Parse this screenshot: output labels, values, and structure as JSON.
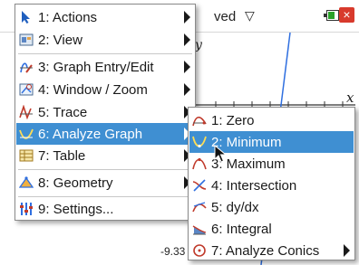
{
  "header": {
    "doc_title": "ved",
    "doc_caret": "▽"
  },
  "graph": {
    "y_label": "y",
    "x_label": "x",
    "x_min_label": "-9.33",
    "colors": {
      "function": "#2f6fe0",
      "axis": "#333333"
    }
  },
  "main_menu": {
    "items": [
      {
        "label": "1: Actions",
        "icon": "pointer-arrow-icon",
        "submenu": true
      },
      {
        "label": "2: View",
        "icon": "view-icon",
        "submenu": true
      },
      {
        "label": "3: Graph Entry/Edit",
        "icon": "graph-entry-icon",
        "submenu": true
      },
      {
        "label": "4: Window / Zoom",
        "icon": "window-zoom-icon",
        "submenu": true
      },
      {
        "label": "5: Trace",
        "icon": "trace-icon",
        "submenu": true
      },
      {
        "label": "6: Analyze Graph",
        "icon": "analyze-graph-icon",
        "submenu": true,
        "highlighted": true
      },
      {
        "label": "7: Table",
        "icon": "table-icon",
        "submenu": true
      },
      {
        "label": "8: Geometry",
        "icon": "geometry-icon",
        "submenu": true
      },
      {
        "label": "9: Settings...",
        "icon": "settings-icon",
        "submenu": false
      }
    ]
  },
  "sub_menu": {
    "items": [
      {
        "label": "1: Zero",
        "icon": "zero-icon"
      },
      {
        "label": "2: Minimum",
        "icon": "minimum-icon",
        "highlighted": true
      },
      {
        "label": "3: Maximum",
        "icon": "maximum-icon"
      },
      {
        "label": "4: Intersection",
        "icon": "intersection-icon"
      },
      {
        "label": "5: dy/dx",
        "icon": "dydx-icon"
      },
      {
        "label": "6: Integral",
        "icon": "integral-icon"
      },
      {
        "label": "7: Analyze Conics",
        "icon": "analyze-conics-icon",
        "submenu": true
      }
    ]
  },
  "colors": {
    "highlight": "#3f8fd2",
    "close": "#d83a2c",
    "battery": "#2aa12a"
  }
}
